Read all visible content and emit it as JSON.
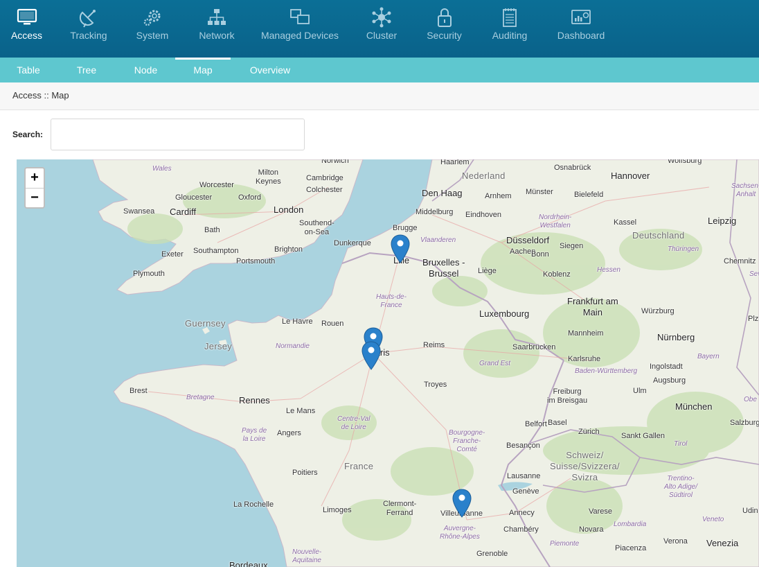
{
  "nav": {
    "items": [
      {
        "label": "Access",
        "icon": "monitor-icon",
        "active": true
      },
      {
        "label": "Tracking",
        "icon": "satellite-dish-icon",
        "active": false
      },
      {
        "label": "System",
        "icon": "gears-icon",
        "active": false
      },
      {
        "label": "Network",
        "icon": "network-tree-icon",
        "active": false
      },
      {
        "label": "Managed Devices",
        "icon": "devices-icon",
        "active": false
      },
      {
        "label": "Cluster",
        "icon": "cluster-icon",
        "active": false
      },
      {
        "label": "Security",
        "icon": "lock-icon",
        "active": false
      },
      {
        "label": "Auditing",
        "icon": "notepad-icon",
        "active": false
      },
      {
        "label": "Dashboard",
        "icon": "dashboard-chart-icon",
        "active": false
      }
    ]
  },
  "subnav": {
    "items": [
      {
        "label": "Table",
        "active": false
      },
      {
        "label": "Tree",
        "active": false
      },
      {
        "label": "Node",
        "active": false
      },
      {
        "label": "Map",
        "active": true
      },
      {
        "label": "Overview",
        "active": false
      }
    ]
  },
  "breadcrumb": "Access :: Map",
  "search": {
    "label": "Search:",
    "value": "",
    "placeholder": ""
  },
  "map": {
    "zoom_in": "+",
    "zoom_out": "−",
    "labels": {
      "norwich": "Norwich",
      "haarlem": "Haarlem",
      "osnabruck": "Osnabrück",
      "wolfsburg": "Wolfsburg",
      "wales": "Wales",
      "milton_keynes": "Milton\nKeynes",
      "cambridge": "Cambridge",
      "nederland": "Nederland",
      "hannover": "Hannover",
      "worcester": "Worcester",
      "colchester": "Colchester",
      "den_haag": "Den Haag",
      "arnhem": "Arnhem",
      "munster": "Münster",
      "bielefeld": "Bielefeld",
      "sachsen_anhalt": "Sachsen-\nAnhalt",
      "swansea": "Swansea",
      "gloucester": "Gloucester",
      "oxford": "Oxford",
      "cardiff": "Cardiff",
      "london": "London",
      "middelburg": "Middelburg",
      "eindhoven": "Eindhoven",
      "kassel": "Kassel",
      "leipzig": "Leipzig",
      "nordrhein": "Nordrhein-\nWestfalen",
      "bath": "Bath",
      "southend": "Southend-\non-Sea",
      "brugge": "Brugge",
      "deutschland": "Deutschland",
      "dunkerque": "Dunkerque",
      "vlaanderen": "Vlaanderen",
      "dusseldorf": "Düsseldorf",
      "siegen": "Siegen",
      "thuringen": "Thüringen",
      "exeter": "Exeter",
      "southampton": "Southampton",
      "brighton": "Brighton",
      "aachen": "Aachen",
      "bonn": "Bonn",
      "chemnitz": "Chemnitz",
      "portsmouth": "Portsmouth",
      "lille": "Lille",
      "bruxelles": "Bruxelles -\nBrussel",
      "hessen": "Hessen",
      "plymouth": "Plymouth",
      "liege": "Liège",
      "koblenz": "Koblenz",
      "hauts_de_france": "Hauts-de-\nFrance",
      "frankfurt": "Frankfurt am\nMain",
      "luxembourg": "Luxembourg",
      "wurzburg": "Würzburg",
      "guernsey": "Guernsey",
      "le_havre": "Le Havre",
      "rouen": "Rouen",
      "mannheim": "Mannheim",
      "nurnberg": "Nürnberg",
      "jersey": "Jersey",
      "normandie": "Normandie",
      "reims": "Reims",
      "saarbrucken": "Saarbrücken",
      "karlsruhe": "Karlsruhe",
      "bayern": "Bayern",
      "ingolstadt": "Ingolstadt",
      "paris": "Paris",
      "grand_est": "Grand Est",
      "baden": "Baden-Württemberg",
      "brest": "Brest",
      "troyes": "Troyes",
      "augsburg": "Augsburg",
      "bretagne": "Bretagne",
      "rennes": "Rennes",
      "freiburg": "Freiburg\nim Breisgau",
      "ulm": "Ulm",
      "munchen": "München",
      "le_mans": "Le Mans",
      "centre": "Centre-Val\nde Loire",
      "belfort": "Belfort",
      "basel": "Basel",
      "zurich": "Zürich",
      "sankt_gallen": "Sankt Gallen",
      "salzburg": "Salzburg",
      "pays_loire": "Pays de\nla Loire",
      "angers": "Angers",
      "bourgogne": "Bourgogne-\nFranche-\nComté",
      "besancon": "Besançon",
      "tirol": "Tirol",
      "schweiz": "Schweiz/\nSuisse/Svizzera/\nSvizra",
      "france": "France",
      "poitiers": "Poitiers",
      "lausanne": "Lausanne",
      "trentino": "Trentino-\nAlto Adige/\nSüdtirol",
      "geneve": "Genève",
      "la_rochelle": "La Rochelle",
      "clermont": "Clermont-\nFerrand",
      "limoges": "Limoges",
      "villeurbanne": "Villeurbanne",
      "annecy": "Annecy",
      "varese": "Varese",
      "auvergne": "Auvergne-\nRhône-Alpes",
      "chambery": "Chambéry",
      "lombardia": "Lombardia",
      "veneto": "Veneto",
      "novara": "Novara",
      "verona": "Verona",
      "venezia": "Venezia",
      "piemonte": "Piemonte",
      "nouvelle_aquitaine": "Nouvelle-\nAquitaine",
      "grenoble": "Grenoble",
      "piacenza": "Piacenza",
      "bordeaux": "Bordeaux",
      "oberbayern": "Obe",
      "udine": "Udin",
      "plz": "Plz",
      "sev": "Sev"
    },
    "markers": [
      "lille-marker",
      "paris-marker-1",
      "paris-marker-2",
      "villeurbanne-marker"
    ],
    "colors": {
      "sea": "#aad3df",
      "land": "#eef0e6",
      "forest": "#c8dfb2",
      "marker": "#2a81cb",
      "nav_bg": "#0a6a90",
      "subnav_bg": "#5ec7cf"
    }
  }
}
